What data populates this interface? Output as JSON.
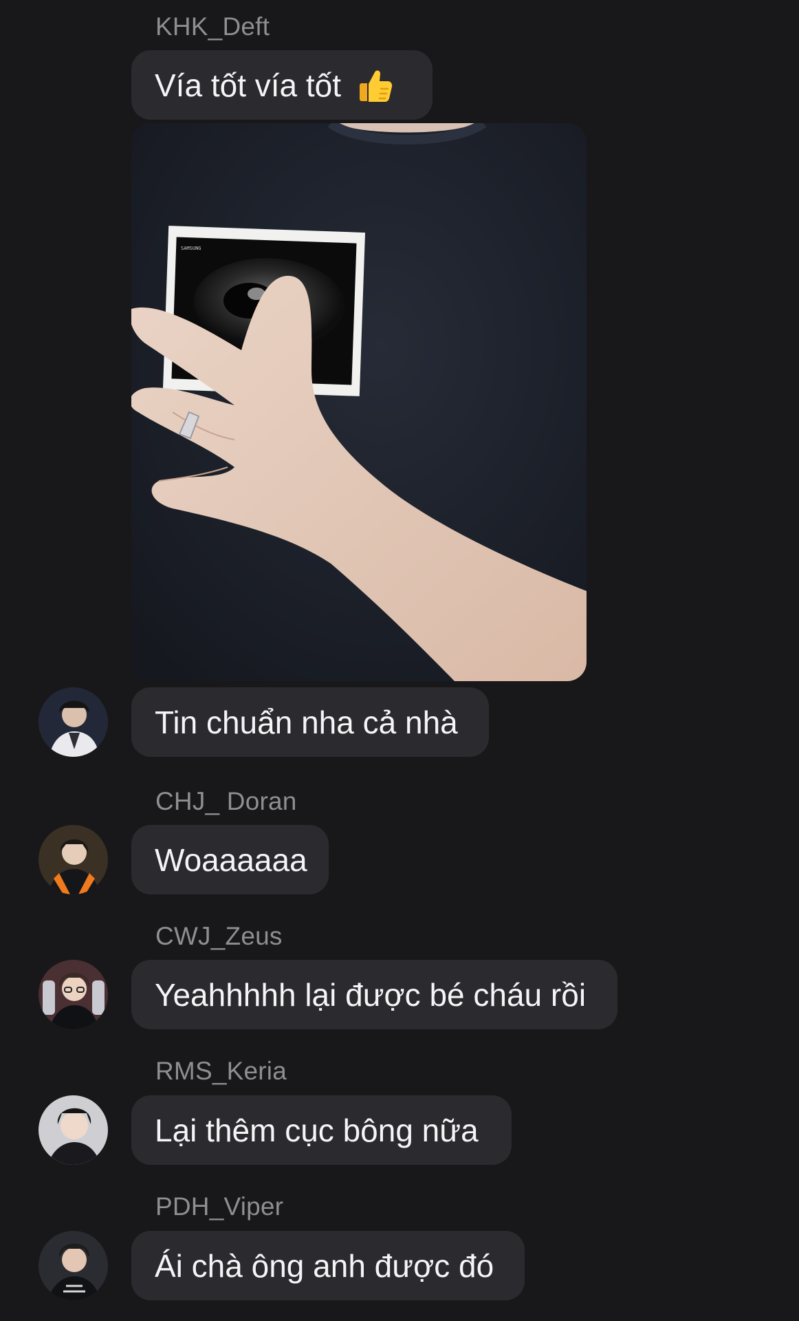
{
  "chat": {
    "messages": [
      {
        "sender": "KHK_Deft",
        "text": "Vía tốt vía tốt",
        "emoji": "thumbs-up-icon"
      },
      {
        "text": "Tin chuẩn nha cả nhà"
      },
      {
        "sender": "CHJ_ Doran",
        "text": "Woaaaaaa"
      },
      {
        "sender": "CWJ_Zeus",
        "text": "Yeahhhhh lại được bé cháu rồi"
      },
      {
        "sender": "RMS_Keria",
        "text": "Lại thêm cục bông nữa"
      },
      {
        "sender": "PDH_Viper",
        "text": "Ái chà ông anh được đó"
      }
    ],
    "photo": {
      "subject": "hand holding ultrasound photo on dark sweater",
      "scan_header": "SAMSUNG"
    }
  },
  "colors": {
    "background": "#18181a",
    "bubble": "#2b2b2f",
    "sender_name": "#8e8e93",
    "text": "#f5f5f7"
  }
}
